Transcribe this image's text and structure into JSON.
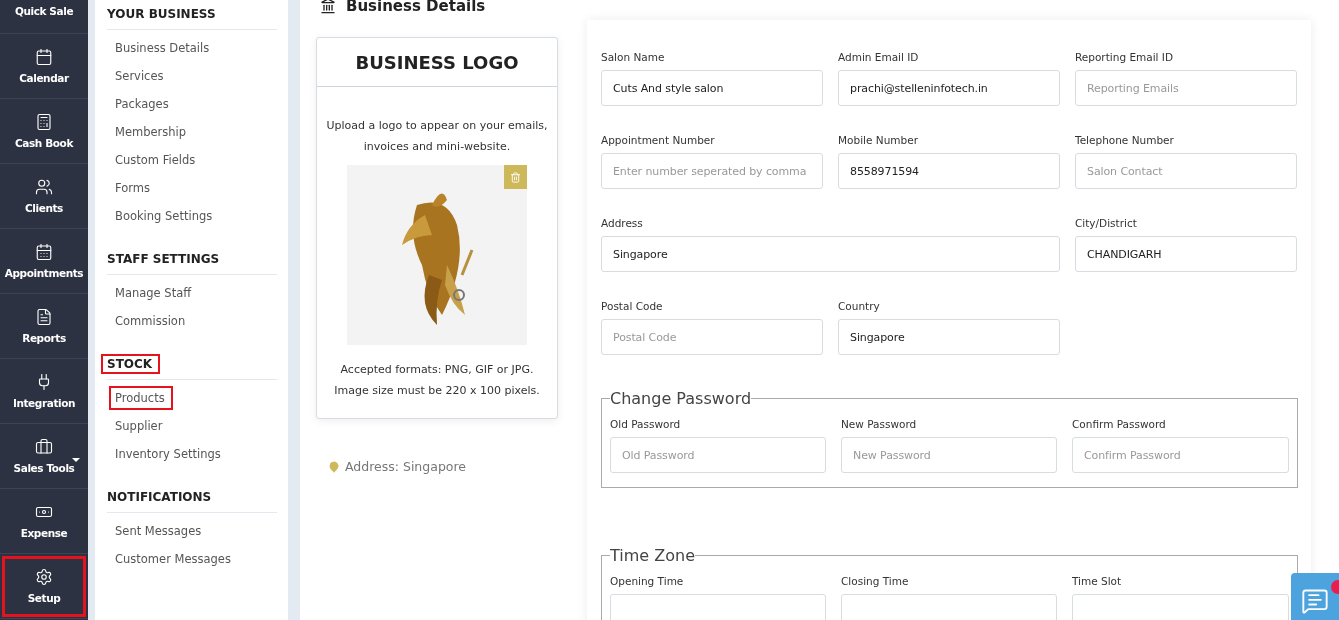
{
  "nav": [
    {
      "label": "Quick Sale",
      "highlighted": false,
      "has_menu": false
    },
    {
      "label": "Calendar",
      "highlighted": false,
      "has_menu": false
    },
    {
      "label": "Cash Book",
      "highlighted": false,
      "has_menu": false
    },
    {
      "label": "Clients",
      "highlighted": false,
      "has_menu": false
    },
    {
      "label": "Appointments",
      "highlighted": false,
      "has_menu": false
    },
    {
      "label": "Reports",
      "highlighted": false,
      "has_menu": false
    },
    {
      "label": "Integration",
      "highlighted": false,
      "has_menu": false
    },
    {
      "label": "Sales Tools",
      "highlighted": false,
      "has_menu": true
    },
    {
      "label": "Expense",
      "highlighted": false,
      "has_menu": false
    },
    {
      "label": "Setup",
      "highlighted": true,
      "has_menu": false
    }
  ],
  "settings_menu": [
    {
      "title": "YOUR BUSINESS",
      "highlighted": false,
      "items": [
        {
          "label": "Business Details",
          "highlighted": false
        },
        {
          "label": "Services",
          "highlighted": false
        },
        {
          "label": "Packages",
          "highlighted": false
        },
        {
          "label": "Membership",
          "highlighted": false
        },
        {
          "label": "Custom Fields",
          "highlighted": false
        },
        {
          "label": "Forms",
          "highlighted": false
        },
        {
          "label": "Booking Settings",
          "highlighted": false
        }
      ]
    },
    {
      "title": "STAFF SETTINGS",
      "highlighted": false,
      "items": [
        {
          "label": "Manage Staff",
          "highlighted": false
        },
        {
          "label": "Commission",
          "highlighted": false
        }
      ]
    },
    {
      "title": "STOCK",
      "highlighted": true,
      "items": [
        {
          "label": "Products",
          "highlighted": true
        },
        {
          "label": "Supplier",
          "highlighted": false
        },
        {
          "label": "Inventory Settings",
          "highlighted": false
        }
      ]
    },
    {
      "title": "NOTIFICATIONS",
      "highlighted": false,
      "items": [
        {
          "label": "Sent Messages",
          "highlighted": false
        },
        {
          "label": "Customer Messages",
          "highlighted": false
        }
      ]
    }
  ],
  "page_title": "Business Details",
  "logo_card": {
    "title": "BUSINESS LOGO",
    "intro": "Upload a logo to appear on your emails, invoices and mini-website.",
    "formats": "Accepted formats: PNG, GIF or JPG. Image size must be 220 x 100 pixels."
  },
  "address_line": "Address: Singapore",
  "form_rows": [
    [
      {
        "label": "Salon Name",
        "value": "Cuts And style salon",
        "wide": false
      },
      {
        "label": "Admin Email ID",
        "value": "prachi@stelleninfotech.in",
        "wide": false
      },
      {
        "label": "Reporting Email ID",
        "placeholder": "Reporting Emails",
        "wide": false
      }
    ],
    [
      {
        "label": "Appointment Number",
        "placeholder": "Enter number seperated by comma",
        "wide": false
      },
      {
        "label": "Mobile Number",
        "value": "8558971594",
        "wide": false
      },
      {
        "label": "Telephone Number",
        "placeholder": "Salon Contact",
        "wide": false
      }
    ],
    [
      {
        "label": "Address",
        "value": "Singapore",
        "wide": true
      },
      {
        "label": "City/District",
        "value": "CHANDIGARH"
      }
    ],
    [
      {
        "label": "Postal Code",
        "placeholder": "Postal Code",
        "wide": false
      },
      {
        "label": "Country",
        "value": "Singapore",
        "wide": false
      }
    ]
  ],
  "change_password": {
    "legend": "Change Password",
    "fields": [
      {
        "label": "Old Password",
        "placeholder": "Old Password"
      },
      {
        "label": "New Password",
        "placeholder": "New Password"
      },
      {
        "label": "Confirm Password",
        "placeholder": "Confirm Password"
      }
    ]
  },
  "time_zone": {
    "legend": "Time Zone",
    "fields": [
      {
        "label": "Opening Time"
      },
      {
        "label": "Closing Time"
      },
      {
        "label": "Time Slot"
      }
    ]
  }
}
